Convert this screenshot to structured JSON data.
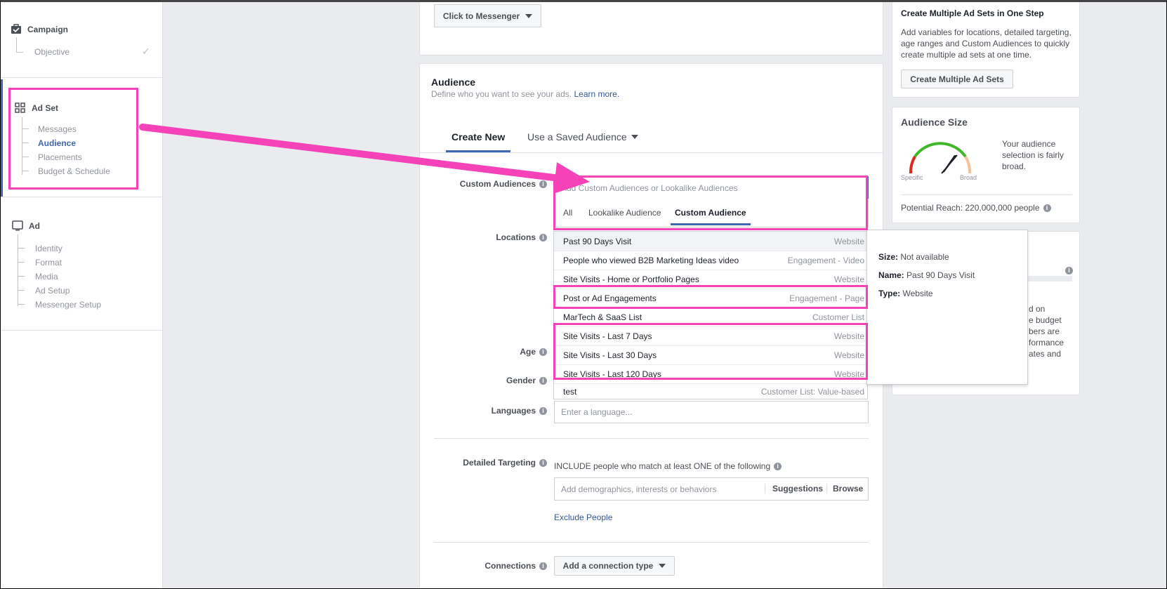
{
  "sidebar": {
    "campaign": {
      "title": "Campaign",
      "items": [
        "Objective"
      ]
    },
    "adset": {
      "title": "Ad Set",
      "items": [
        "Messages",
        "Audience",
        "Placements",
        "Budget & Schedule"
      ],
      "active": "Audience"
    },
    "ad": {
      "title": "Ad",
      "items": [
        "Identity",
        "Format",
        "Media",
        "Ad Setup",
        "Messenger Setup"
      ]
    }
  },
  "top_button": "Click to Messenger",
  "audience": {
    "title": "Audience",
    "description": "Define who you want to see your ads.",
    "learn_more": "Learn more.",
    "tabs": [
      "Create New",
      "Use a Saved Audience"
    ],
    "custom_audiences_label": "Custom Audiences",
    "custom_audiences_placeholder": "Add Custom Audiences or Lookalike Audiences",
    "filter_tabs": [
      "All",
      "Lookalike Audience",
      "Custom Audience"
    ],
    "active_filter": "Custom Audience",
    "options": [
      {
        "name": "Past 90 Days Visit",
        "type": "Website"
      },
      {
        "name": "People who viewed B2B Marketing Ideas video",
        "type": "Engagement - Video"
      },
      {
        "name": "Site Visits - Home or Portfolio Pages",
        "type": "Website"
      },
      {
        "name": "Post or Ad Engagements",
        "type": "Engagement - Page"
      },
      {
        "name": "MarTech & SaaS List",
        "type": "Customer List"
      },
      {
        "name": "Site Visits - Last 7 Days",
        "type": "Website"
      },
      {
        "name": "Site Visits - Last 30 Days",
        "type": "Website"
      },
      {
        "name": "Site Visits - Last 120 Days",
        "type": "Website"
      },
      {
        "name": "test",
        "type": "Customer List: Value-based"
      }
    ],
    "locations_label": "Locations",
    "age_label": "Age",
    "gender_label": "Gender",
    "languages_label": "Languages",
    "languages_placeholder": "Enter a language...",
    "detailed_targeting_label": "Detailed Targeting",
    "include_text": "INCLUDE people who match at least ONE of the following",
    "detailed_placeholder": "Add demographics, interests or behaviors",
    "suggestions": "Suggestions",
    "browse": "Browse",
    "exclude_people": "Exclude People",
    "connections_label": "Connections",
    "connections_button": "Add a connection type"
  },
  "tooltip": {
    "size_label": "Size:",
    "size_value": "Not available",
    "name_label": "Name:",
    "name_value": "Past 90 Days Visit",
    "type_label": "Type:",
    "type_value": "Website"
  },
  "right": {
    "multi_title": "Create Multiple Ad Sets in One Step",
    "multi_text": "Add variables for locations, detailed targeting, age ranges and Custom Audiences to quickly create multiple ad sets at one time.",
    "multi_button": "Create Multiple Ad Sets",
    "size_title": "Audience Size",
    "gauge_specific": "Specific",
    "gauge_broad": "Broad",
    "size_text": "Your audience selection is fairly broad.",
    "potential_reach": "Potential Reach: 220,000,000 people",
    "partial_lines": [
      "d on",
      "e budget",
      "bers are",
      "formance",
      "ates and"
    ]
  },
  "colors": {
    "highlight": "#f542b8",
    "accent": "#4267b2",
    "tab_underline": "#4267b2"
  }
}
